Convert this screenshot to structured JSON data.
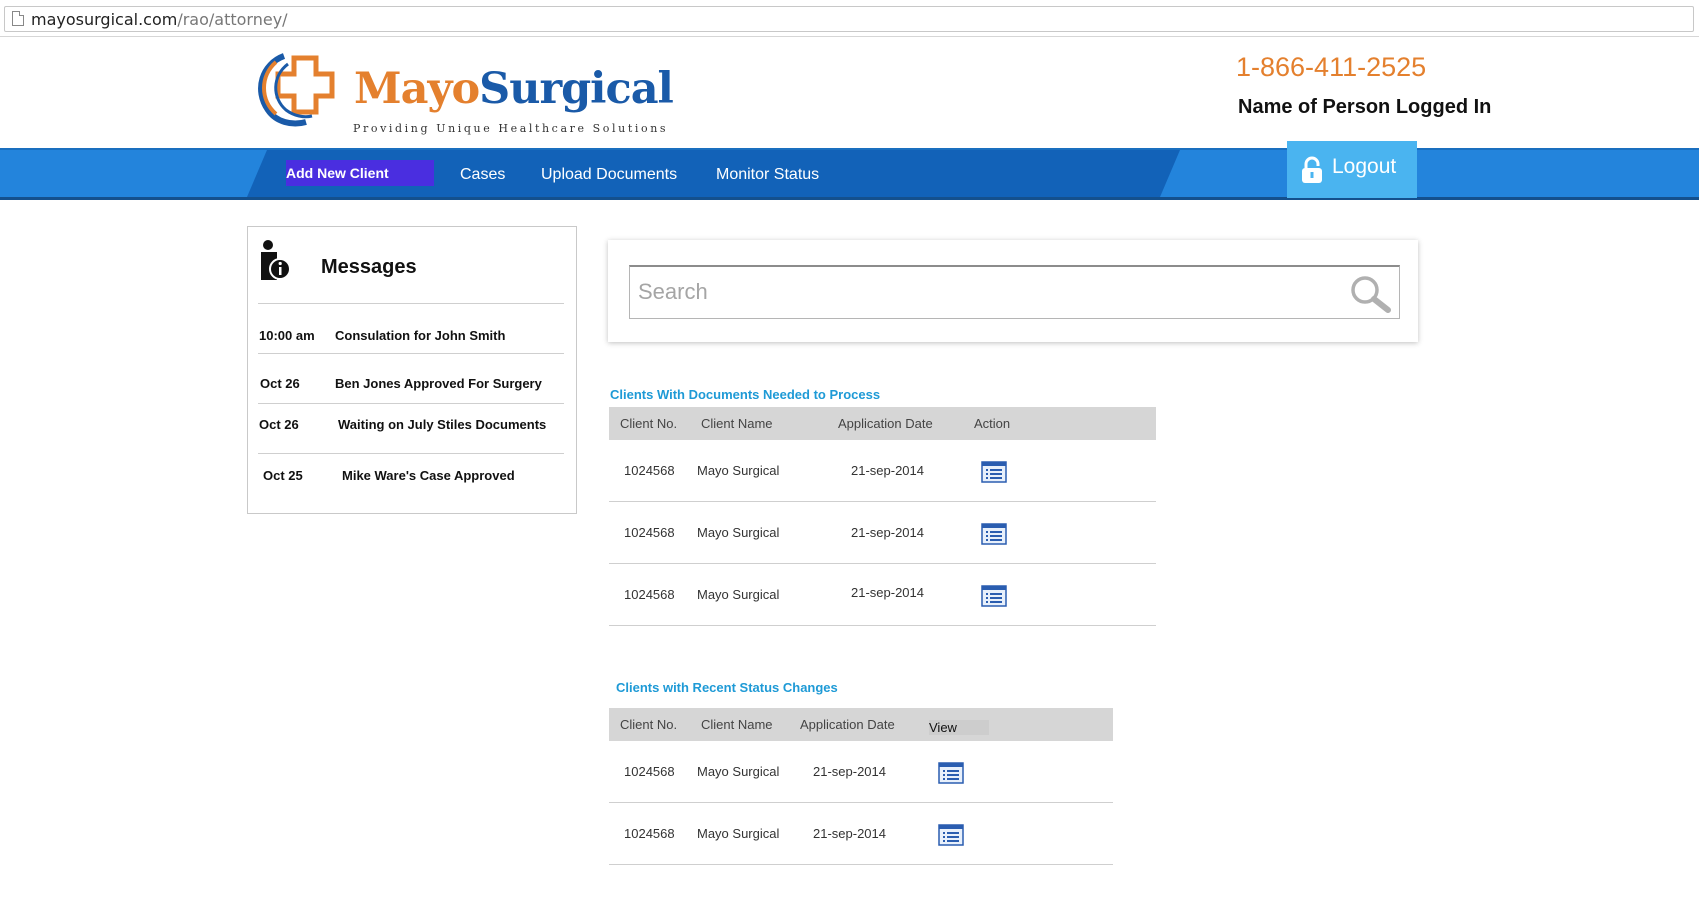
{
  "browser": {
    "url_domain": "mayosurgical.com",
    "url_path": "/rao/attorney/"
  },
  "header": {
    "brand_part1": "Mayo",
    "brand_part2": "Surgical",
    "tagline": "Providing Unique Healthcare Solutions",
    "phone": "1-866-411-2525",
    "user_name": "Name of Person Logged In"
  },
  "nav": {
    "add_new_client": "Add New Client",
    "cases": "Cases",
    "upload_documents": "Upload Documents",
    "monitor_status": "Monitor Status",
    "logout": "Logout"
  },
  "messages": {
    "title": "Messages",
    "items": [
      {
        "time": "10:00 am",
        "text": "Consulation for John Smith"
      },
      {
        "time": "Oct 26",
        "text": "Ben Jones Approved For Surgery"
      },
      {
        "time": "Oct 26",
        "text": "Waiting on July Stiles Documents"
      },
      {
        "time": "Oct 25",
        "text": "Mike Ware's Case Approved"
      }
    ]
  },
  "search": {
    "placeholder": "Search"
  },
  "documents_needed": {
    "title": "Clients With Documents Needed to Process",
    "headers": [
      "Client No.",
      "Client Name",
      "Application Date",
      "Action"
    ],
    "rows": [
      {
        "client_no": "1024568",
        "client_name": "Mayo Surgical",
        "date": "21-sep-2014"
      },
      {
        "client_no": "1024568",
        "client_name": "Mayo Surgical",
        "date": "21-sep-2014"
      },
      {
        "client_no": "1024568",
        "client_name": "Mayo Surgical",
        "date": "21-sep-2014"
      }
    ]
  },
  "status_changes": {
    "title": "Clients with Recent Status Changes",
    "headers": [
      "Client No.",
      "Client Name",
      "Application Date",
      "View"
    ],
    "rows": [
      {
        "client_no": "1024568",
        "client_name": "Mayo Surgical",
        "date": "21-sep-2014"
      },
      {
        "client_no": "1024568",
        "client_name": "Mayo Surgical",
        "date": "21-sep-2014"
      }
    ]
  },
  "colors": {
    "brand_orange": "#e4802e",
    "brand_blue": "#1a5aa8",
    "nav_blue": "#2384dc",
    "accent_cyan": "#1e9ad6",
    "logout_bg": "#4ab4f0"
  }
}
